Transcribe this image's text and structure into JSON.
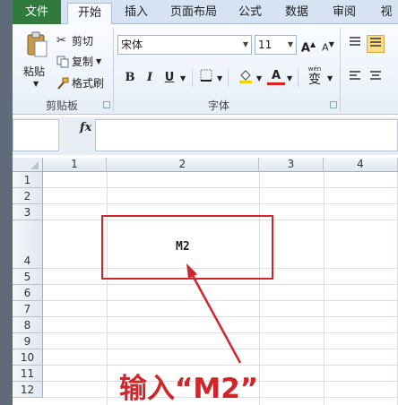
{
  "tabs": [
    "文件",
    "开始",
    "插入",
    "页面布局",
    "公式",
    "数据",
    "审阅",
    "视"
  ],
  "clipboard": {
    "paste_label": "粘贴",
    "cut_label": "剪切",
    "copy_label": "复制",
    "format_painter_label": "格式刷",
    "group_label": "剪贴板"
  },
  "font": {
    "family": "宋体",
    "size": "11",
    "bold": "B",
    "italic": "I",
    "underline": "U",
    "font_color_glyph": "A",
    "grow_glyph": "A",
    "shrink_glyph": "A",
    "phonetic_glyph": "变",
    "phonetic_top": "wén",
    "group_label": "字体"
  },
  "formula_bar": {
    "fx": "fx",
    "value": ""
  },
  "columns": [
    "1",
    "2",
    "3",
    "4"
  ],
  "rows": [
    "1",
    "2",
    "3",
    "4",
    "5",
    "6",
    "7",
    "8",
    "9",
    "10",
    "11",
    "12"
  ],
  "cell": {
    "value": "M2"
  },
  "annotation": "输入“M2”",
  "colors": {
    "file_tab": "#2f7a3c",
    "highlight": "#d0262b",
    "font_color_underline": "#e0201b",
    "fill_highlight": "#f5d500"
  }
}
